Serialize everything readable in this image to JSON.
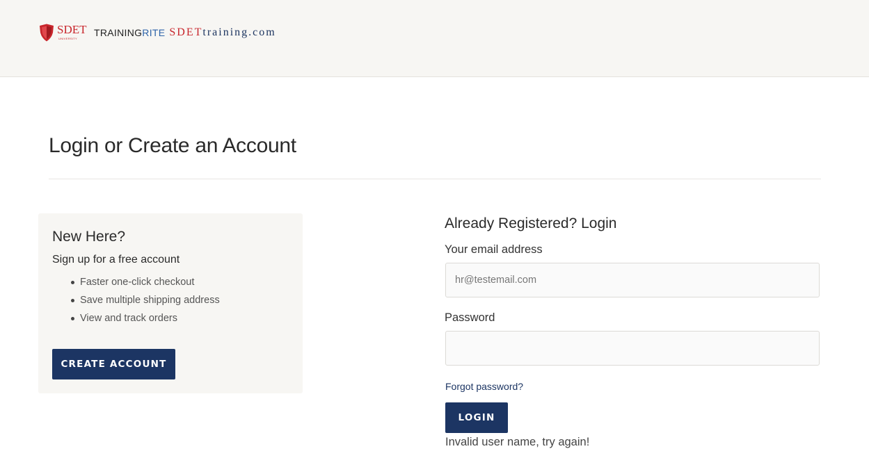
{
  "header": {
    "logo": {
      "sdet_university_text": "SDET",
      "sdet_university_small": "UNIVERSITY",
      "trainingrite_part1": "TRAINING",
      "trainingrite_part2": "RITE",
      "sdettraining_part1": "SDET",
      "sdettraining_part2": "training.com"
    }
  },
  "page_title": "Login or Create an Account",
  "new_account": {
    "title": "New Here?",
    "subtitle": "Sign up for a free account",
    "benefits": [
      "Faster one-click checkout",
      "Save multiple shipping address",
      "View and track orders"
    ],
    "button_label": "CREATE ACCOUNT"
  },
  "login": {
    "title": "Already Registered? Login",
    "email_label": "Your email address",
    "email_placeholder": "hr@testemail.com",
    "email_value": "",
    "password_label": "Password",
    "password_value": "",
    "forgot_label": "Forgot password?",
    "button_label": "LOGIN",
    "error_message": "Invalid user name, try again!"
  },
  "colors": {
    "brand_navy": "#1c3563",
    "brand_red": "#c8262c",
    "panel_bg": "#f7f6f3"
  }
}
